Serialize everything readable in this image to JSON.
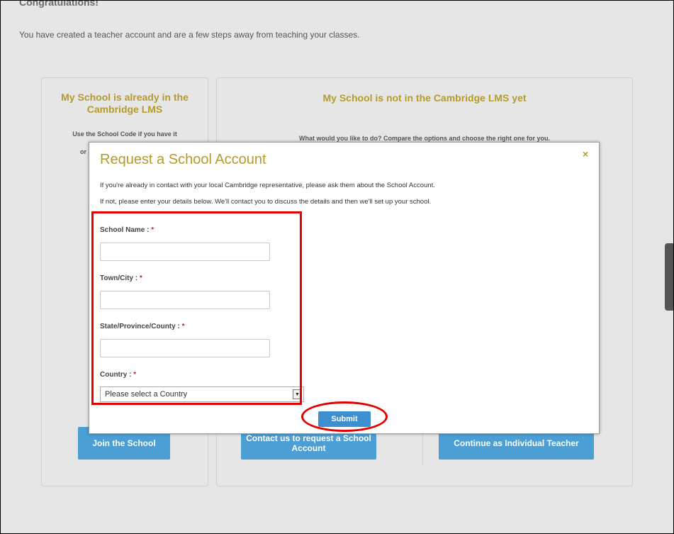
{
  "page": {
    "congrats_heading": "Congratulations!",
    "intro_text": "You have created a teacher account and are a few steps away from teaching your classes."
  },
  "left_panel": {
    "title": "My School is already in the Cambridge LMS",
    "description": "Use the School Code if you have it",
    "fragment": "or",
    "join_button": "Join the School"
  },
  "right_panel": {
    "title": "My School is not in the Cambridge LMS yet",
    "description": "What would you like to do? Compare the options and choose the right one for you.",
    "contact_button": "Contact us to request a School Account",
    "individual_button": "Continue as Individual Teacher"
  },
  "modal": {
    "title": "Request a School Account",
    "close_glyph": "×",
    "line1": "If you're already in contact with your local Cambridge representative, please ask them about the School Account.",
    "line2": "If not, please enter your details below. We'll contact you to discuss the details and then we'll set up your school.",
    "required_mark": "*",
    "fields": {
      "school_name": {
        "label": "School Name :",
        "value": ""
      },
      "town_city": {
        "label": "Town/City :",
        "value": ""
      },
      "state": {
        "label": "State/Province/County :",
        "value": ""
      },
      "country": {
        "label": "Country :",
        "selected": "Please select a Country"
      }
    },
    "submit_label": "Submit"
  },
  "icons": {
    "close": "close-icon",
    "select_arrow": "chevron-down-icon"
  },
  "colors": {
    "gold_heading": "#b59a2e",
    "button_blue": "#4b9fd5",
    "annotation_red": "#e30000",
    "required_red": "#c0262c"
  }
}
